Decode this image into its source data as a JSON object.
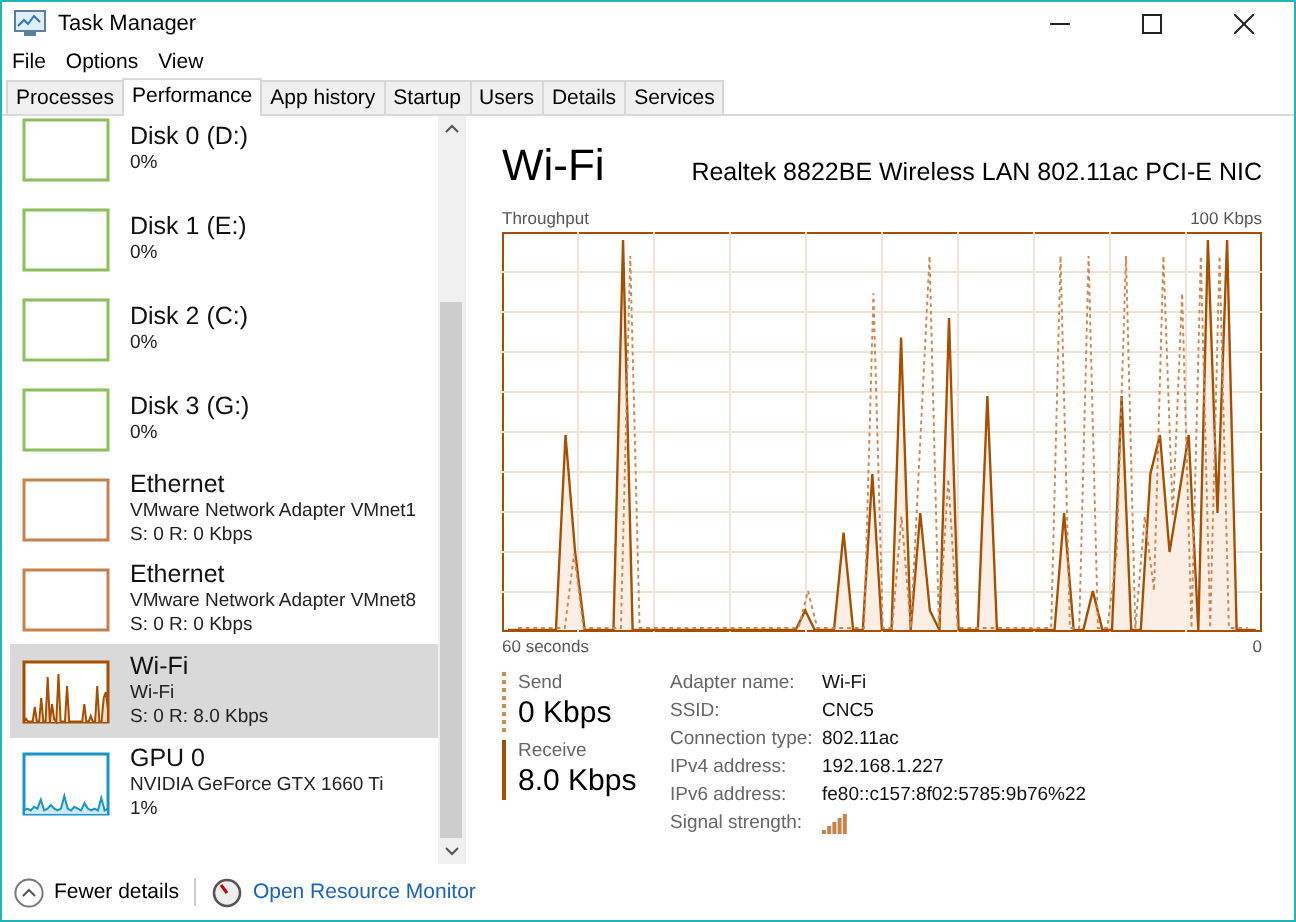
{
  "window": {
    "title": "Task Manager"
  },
  "menu": [
    "File",
    "Options",
    "View"
  ],
  "tabs": [
    {
      "label": "Processes",
      "selected": false
    },
    {
      "label": "Performance",
      "selected": true
    },
    {
      "label": "App history",
      "selected": false
    },
    {
      "label": "Startup",
      "selected": false
    },
    {
      "label": "Users",
      "selected": false
    },
    {
      "label": "Details",
      "selected": false
    },
    {
      "label": "Services",
      "selected": false
    }
  ],
  "sidebar": {
    "items": [
      {
        "kind": "disk",
        "title": "Disk 0 (D:)",
        "lines": [
          "0%"
        ],
        "selected": false
      },
      {
        "kind": "disk",
        "title": "Disk 1 (E:)",
        "lines": [
          "0%"
        ],
        "selected": false
      },
      {
        "kind": "disk",
        "title": "Disk 2 (C:)",
        "lines": [
          "0%"
        ],
        "selected": false
      },
      {
        "kind": "disk",
        "title": "Disk 3 (G:)",
        "lines": [
          "0%"
        ],
        "selected": false
      },
      {
        "kind": "ethernet",
        "title": "Ethernet",
        "lines": [
          "VMware Network Adapter VMnet1",
          "S: 0 R: 0 Kbps"
        ],
        "selected": false
      },
      {
        "kind": "ethernet",
        "title": "Ethernet",
        "lines": [
          "VMware Network Adapter VMnet8",
          "S: 0 R: 0 Kbps"
        ],
        "selected": false
      },
      {
        "kind": "wifi",
        "title": "Wi-Fi",
        "lines": [
          "Wi-Fi",
          "S: 0 R: 8.0 Kbps"
        ],
        "selected": true
      },
      {
        "kind": "gpu",
        "title": "GPU 0",
        "lines": [
          "NVIDIA GeForce GTX 1660 Ti",
          "1%"
        ],
        "selected": false
      }
    ]
  },
  "detail": {
    "title": "Wi-Fi",
    "device": "Realtek 8822BE Wireless LAN 802.11ac PCI-E NIC",
    "graph": {
      "label": "Throughput",
      "max": "100 Kbps",
      "span": "60 seconds",
      "min": "0"
    },
    "send": {
      "label": "Send",
      "value": "0 Kbps"
    },
    "receive": {
      "label": "Receive",
      "value": "8.0 Kbps"
    },
    "properties": [
      {
        "label": "Adapter name:",
        "value": "Wi-Fi",
        "kind": "text"
      },
      {
        "label": "SSID:",
        "value": "CNC5",
        "kind": "text"
      },
      {
        "label": "Connection type:",
        "value": "802.11ac",
        "kind": "text"
      },
      {
        "label": "IPv4 address:",
        "value": "192.168.1.227",
        "kind": "text"
      },
      {
        "label": "IPv6 address:",
        "value": "fe80::c157:8f02:5785:9b76%22",
        "kind": "text"
      },
      {
        "label": "Signal strength:",
        "kind": "signal"
      }
    ]
  },
  "footer": {
    "fewer_details": "Fewer details",
    "resource_monitor": "Open Resource Monitor"
  }
}
